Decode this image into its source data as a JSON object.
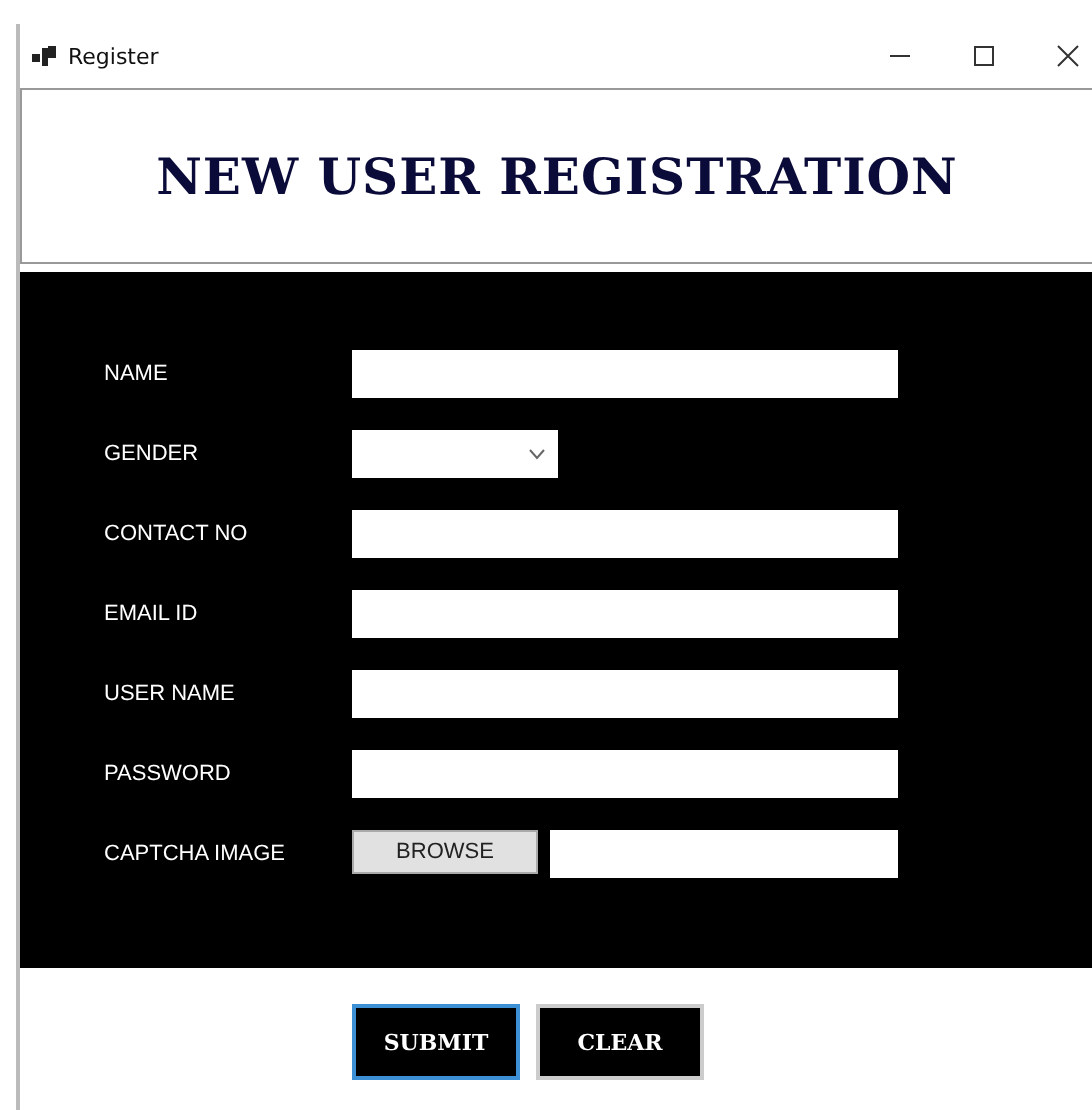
{
  "window": {
    "title": "Register"
  },
  "heading": "NEW USER REGISTRATION",
  "fields": [
    {
      "label": "NAME",
      "kind": "text"
    },
    {
      "label": "GENDER",
      "kind": "dropdown"
    },
    {
      "label": "CONTACT NO",
      "kind": "text"
    },
    {
      "label": "EMAIL ID",
      "kind": "text"
    },
    {
      "label": "USER NAME",
      "kind": "text"
    },
    {
      "label": "PASSWORD",
      "kind": "text"
    },
    {
      "label": "CAPTCHA IMAGE",
      "kind": "file",
      "button": "BROWSE"
    }
  ],
  "buttons": [
    {
      "label": "SUBMIT",
      "focused": true
    },
    {
      "label": "CLEAR",
      "focused": false
    }
  ]
}
